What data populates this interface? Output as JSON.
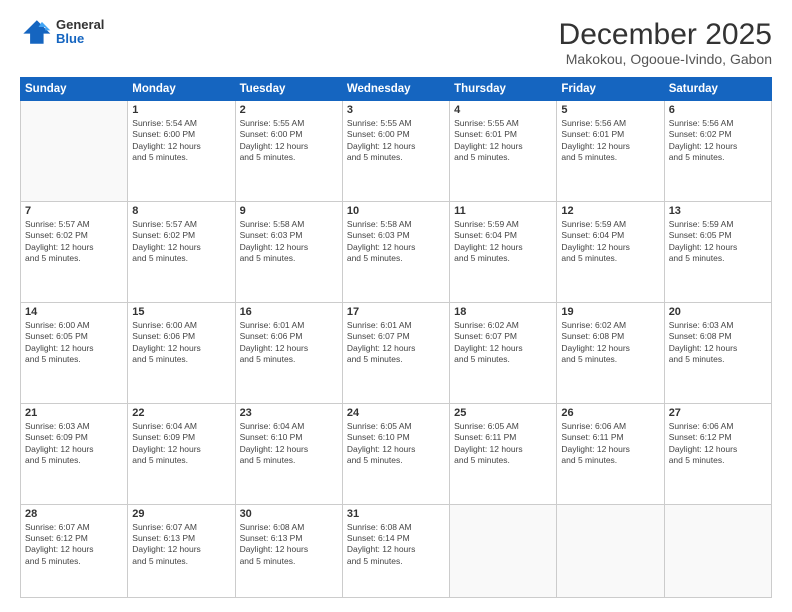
{
  "logo": {
    "general": "General",
    "blue": "Blue"
  },
  "header": {
    "title": "December 2025",
    "subtitle": "Makokou, Ogooue-Ivindo, Gabon"
  },
  "weekdays": [
    "Sunday",
    "Monday",
    "Tuesday",
    "Wednesday",
    "Thursday",
    "Friday",
    "Saturday"
  ],
  "weeks": [
    [
      {
        "day": "",
        "info": ""
      },
      {
        "day": "1",
        "info": "Sunrise: 5:54 AM\nSunset: 6:00 PM\nDaylight: 12 hours\nand 5 minutes."
      },
      {
        "day": "2",
        "info": "Sunrise: 5:55 AM\nSunset: 6:00 PM\nDaylight: 12 hours\nand 5 minutes."
      },
      {
        "day": "3",
        "info": "Sunrise: 5:55 AM\nSunset: 6:00 PM\nDaylight: 12 hours\nand 5 minutes."
      },
      {
        "day": "4",
        "info": "Sunrise: 5:55 AM\nSunset: 6:01 PM\nDaylight: 12 hours\nand 5 minutes."
      },
      {
        "day": "5",
        "info": "Sunrise: 5:56 AM\nSunset: 6:01 PM\nDaylight: 12 hours\nand 5 minutes."
      },
      {
        "day": "6",
        "info": "Sunrise: 5:56 AM\nSunset: 6:02 PM\nDaylight: 12 hours\nand 5 minutes."
      }
    ],
    [
      {
        "day": "7",
        "info": "Sunrise: 5:57 AM\nSunset: 6:02 PM\nDaylight: 12 hours\nand 5 minutes."
      },
      {
        "day": "8",
        "info": "Sunrise: 5:57 AM\nSunset: 6:02 PM\nDaylight: 12 hours\nand 5 minutes."
      },
      {
        "day": "9",
        "info": "Sunrise: 5:58 AM\nSunset: 6:03 PM\nDaylight: 12 hours\nand 5 minutes."
      },
      {
        "day": "10",
        "info": "Sunrise: 5:58 AM\nSunset: 6:03 PM\nDaylight: 12 hours\nand 5 minutes."
      },
      {
        "day": "11",
        "info": "Sunrise: 5:59 AM\nSunset: 6:04 PM\nDaylight: 12 hours\nand 5 minutes."
      },
      {
        "day": "12",
        "info": "Sunrise: 5:59 AM\nSunset: 6:04 PM\nDaylight: 12 hours\nand 5 minutes."
      },
      {
        "day": "13",
        "info": "Sunrise: 5:59 AM\nSunset: 6:05 PM\nDaylight: 12 hours\nand 5 minutes."
      }
    ],
    [
      {
        "day": "14",
        "info": "Sunrise: 6:00 AM\nSunset: 6:05 PM\nDaylight: 12 hours\nand 5 minutes."
      },
      {
        "day": "15",
        "info": "Sunrise: 6:00 AM\nSunset: 6:06 PM\nDaylight: 12 hours\nand 5 minutes."
      },
      {
        "day": "16",
        "info": "Sunrise: 6:01 AM\nSunset: 6:06 PM\nDaylight: 12 hours\nand 5 minutes."
      },
      {
        "day": "17",
        "info": "Sunrise: 6:01 AM\nSunset: 6:07 PM\nDaylight: 12 hours\nand 5 minutes."
      },
      {
        "day": "18",
        "info": "Sunrise: 6:02 AM\nSunset: 6:07 PM\nDaylight: 12 hours\nand 5 minutes."
      },
      {
        "day": "19",
        "info": "Sunrise: 6:02 AM\nSunset: 6:08 PM\nDaylight: 12 hours\nand 5 minutes."
      },
      {
        "day": "20",
        "info": "Sunrise: 6:03 AM\nSunset: 6:08 PM\nDaylight: 12 hours\nand 5 minutes."
      }
    ],
    [
      {
        "day": "21",
        "info": "Sunrise: 6:03 AM\nSunset: 6:09 PM\nDaylight: 12 hours\nand 5 minutes."
      },
      {
        "day": "22",
        "info": "Sunrise: 6:04 AM\nSunset: 6:09 PM\nDaylight: 12 hours\nand 5 minutes."
      },
      {
        "day": "23",
        "info": "Sunrise: 6:04 AM\nSunset: 6:10 PM\nDaylight: 12 hours\nand 5 minutes."
      },
      {
        "day": "24",
        "info": "Sunrise: 6:05 AM\nSunset: 6:10 PM\nDaylight: 12 hours\nand 5 minutes."
      },
      {
        "day": "25",
        "info": "Sunrise: 6:05 AM\nSunset: 6:11 PM\nDaylight: 12 hours\nand 5 minutes."
      },
      {
        "day": "26",
        "info": "Sunrise: 6:06 AM\nSunset: 6:11 PM\nDaylight: 12 hours\nand 5 minutes."
      },
      {
        "day": "27",
        "info": "Sunrise: 6:06 AM\nSunset: 6:12 PM\nDaylight: 12 hours\nand 5 minutes."
      }
    ],
    [
      {
        "day": "28",
        "info": "Sunrise: 6:07 AM\nSunset: 6:12 PM\nDaylight: 12 hours\nand 5 minutes."
      },
      {
        "day": "29",
        "info": "Sunrise: 6:07 AM\nSunset: 6:13 PM\nDaylight: 12 hours\nand 5 minutes."
      },
      {
        "day": "30",
        "info": "Sunrise: 6:08 AM\nSunset: 6:13 PM\nDaylight: 12 hours\nand 5 minutes."
      },
      {
        "day": "31",
        "info": "Sunrise: 6:08 AM\nSunset: 6:14 PM\nDaylight: 12 hours\nand 5 minutes."
      },
      {
        "day": "",
        "info": ""
      },
      {
        "day": "",
        "info": ""
      },
      {
        "day": "",
        "info": ""
      }
    ]
  ]
}
